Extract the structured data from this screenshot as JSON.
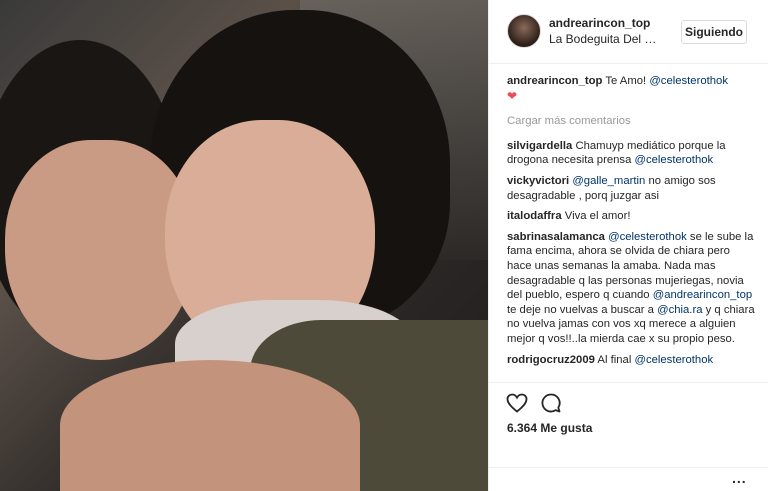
{
  "post": {
    "username": "andrearincon_top",
    "location": "La Bodeguita Del M...",
    "follow_label": "Siguiendo"
  },
  "caption": {
    "user": "andrearincon_top",
    "text": "Te Amo!",
    "mention": "@celesterothok",
    "heart": "❤"
  },
  "load_more_label": "Cargar más comentarios",
  "comments": [
    {
      "user": "silvigardella",
      "pre": "Chamuyp mediático porque la drogona necesita prensa",
      "mention": "@celesterothok",
      "post": ""
    },
    {
      "user": "vickyvictori",
      "pre": "",
      "mention": "@galle_martin",
      "post": "no amigo sos desagradable , porq juzgar asi"
    },
    {
      "user": "italodaffra",
      "pre": "Viva el amor!",
      "mention": "",
      "post": ""
    },
    {
      "user": "sabrinasalamanca",
      "pre": "",
      "mention": "@celesterothok",
      "post": "se le sube la fama encima, ahora se olvida de chiara pero hace unas semanas la amaba. Nada mas desagradable q las personas mujeriegas, novia del pueblo, espero q cuando",
      "mention2": "@andrearincon_top",
      "post2": "te deje no vuelvas a buscar a",
      "mention3": "@chia.ra",
      "post3": "y q chiara no vuelva jamas con vos xq merece a alguien mejor q vos!!..la mierda cae x su propio peso."
    },
    {
      "user": "rodrigocruz2009",
      "pre": "Al final",
      "mention": "@celesterothok",
      "post": ""
    }
  ],
  "likes_label": "6.364 Me gusta",
  "more_label": "..."
}
